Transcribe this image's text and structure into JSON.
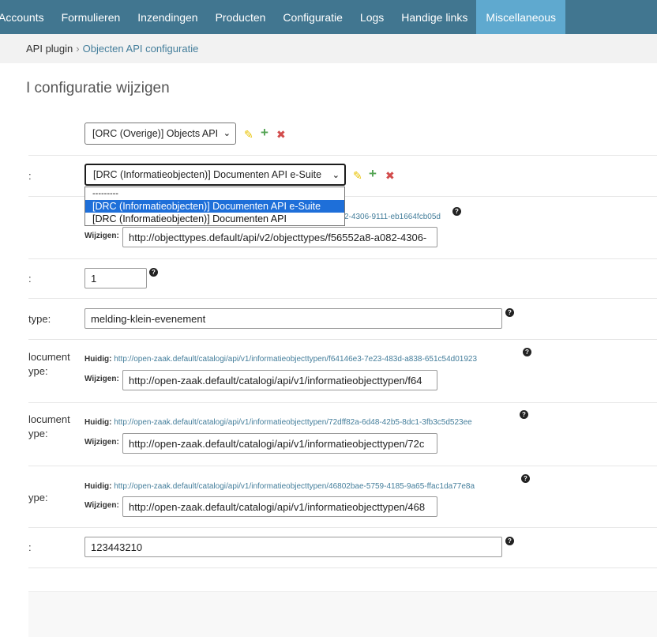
{
  "nav": {
    "items": [
      {
        "label": "Accounts"
      },
      {
        "label": "Formulieren"
      },
      {
        "label": "Inzendingen"
      },
      {
        "label": "Producten"
      },
      {
        "label": "Configuratie"
      },
      {
        "label": "Logs"
      },
      {
        "label": "Handige links"
      },
      {
        "label": "Miscellaneous"
      }
    ]
  },
  "breadcrumb": {
    "plugin": "API plugin",
    "separator": "›",
    "current": "Objecten API configuratie"
  },
  "page": {
    "title": "I configuratie wijzigen"
  },
  "form": {
    "objects_service": {
      "value": "[ORC (Overige)] Objects API"
    },
    "drc_service": {
      "label": ":",
      "value": "[DRC (Informatieobjecten)] Documenten API e-Suite",
      "options": [
        {
          "label": "---------"
        },
        {
          "label": "[DRC (Informatieobjecten)] Documenten API e-Suite"
        },
        {
          "label": "[DRC (Informatieobjecten)] Documenten API"
        }
      ]
    },
    "objecttype": {
      "huidig_url_fragment": "2-4306-9111-eb1664fcb05d",
      "wijzigen_label": "Wijzigen:",
      "wijzigen_value": "http://objecttypes.default/api/v2/objecttypes/f56552a8-a082-4306-"
    },
    "objecttype_version": {
      "label": ":",
      "value": "1"
    },
    "productaanvraag_type": {
      "label": "type:",
      "value": "melding-klein-evenement"
    },
    "iot_submission_report": {
      "label_line1": "locument",
      "label_line2": "ype:",
      "huidig_label": "Huidig:",
      "huidig_url": "http://open-zaak.default/catalogi/api/v1/informatieobjecttypen/f64146e3-7e23-483d-a838-651c54d01923",
      "wijzigen_label": "Wijzigen:",
      "wijzigen_value": "http://open-zaak.default/catalogi/api/v1/informatieobjecttypen/f64"
    },
    "iot_submission_csv": {
      "label_line1": "locument",
      "label_line2": "ype:",
      "huidig_label": "Huidig:",
      "huidig_url": "http://open-zaak.default/catalogi/api/v1/informatieobjecttypen/72dff82a-6d48-42b5-8dc1-3fb3c5d523ee",
      "wijzigen_label": "Wijzigen:",
      "wijzigen_value": "http://open-zaak.default/catalogi/api/v1/informatieobjecttypen/72c"
    },
    "iot_attachment": {
      "label": "ype:",
      "huidig_label": "Huidig:",
      "huidig_url": "http://open-zaak.default/catalogi/api/v1/informatieobjecttypen/46802bae-5759-4185-9a65-ffac1da77e8a",
      "wijzigen_label": "Wijzigen:",
      "wijzigen_value": "http://open-zaak.default/catalogi/api/v1/informatieobjecttypen/468"
    },
    "organisatie_rsin": {
      "label": ":",
      "value": "123443210"
    }
  },
  "icons": {
    "edit": "✎",
    "add": "+",
    "delete": "✖",
    "help": "?",
    "chevron": "⌄"
  }
}
